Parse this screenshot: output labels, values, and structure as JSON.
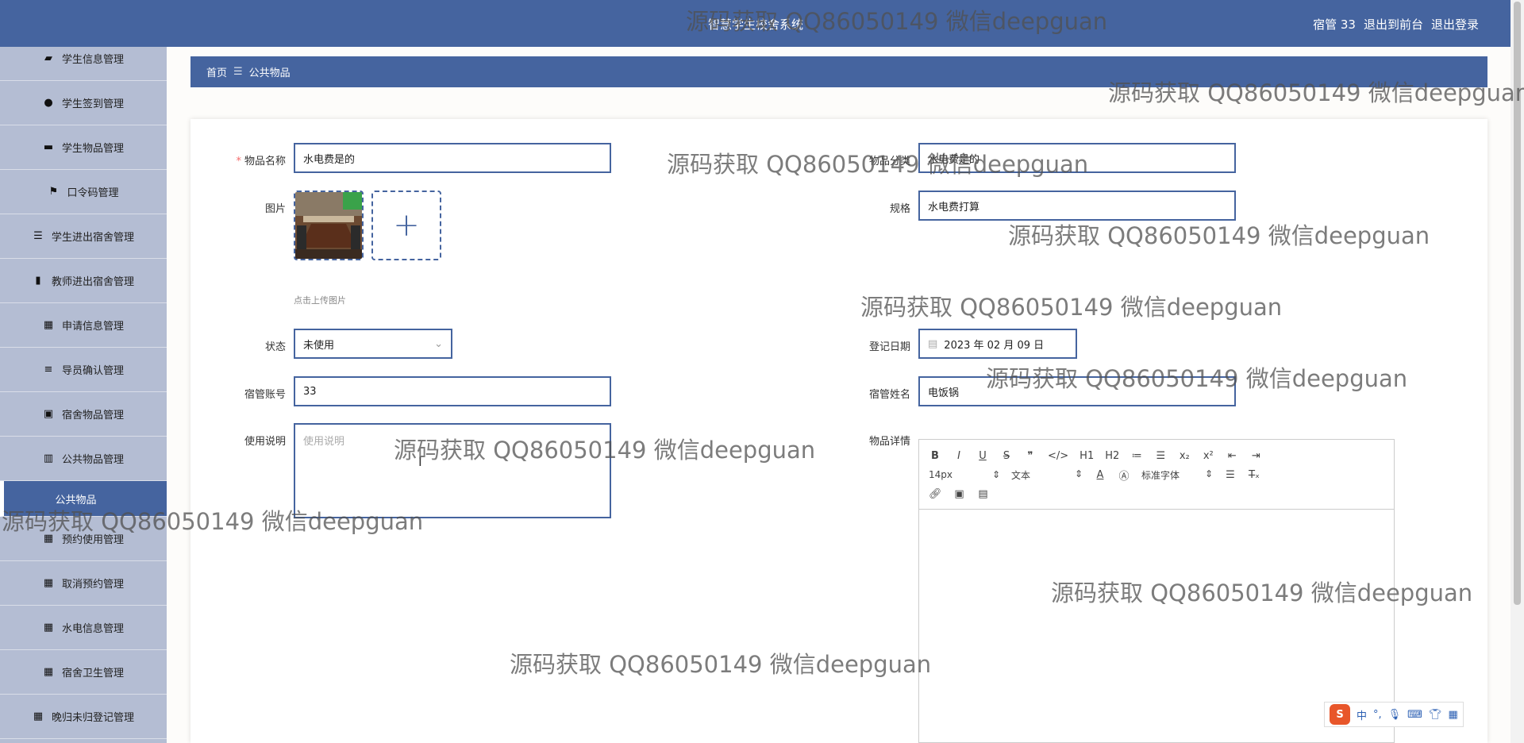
{
  "header": {
    "title": "智慧学生校舍系统",
    "user": "宿管 33",
    "to_front": "退出到前台",
    "logout": "退出登录"
  },
  "sidebar": {
    "items": [
      {
        "label": "学生信息管理",
        "icon": "briefcase-icon"
      },
      {
        "label": "学生签到管理",
        "icon": "pin-icon"
      },
      {
        "label": "学生物品管理",
        "icon": "chat-icon"
      },
      {
        "label": "口令码管理",
        "icon": "flag-icon"
      },
      {
        "label": "学生进出宿舍管理",
        "icon": "sliders-icon"
      },
      {
        "label": "教师进出宿舍管理",
        "icon": "bar-chart-icon"
      },
      {
        "label": "申请信息管理",
        "icon": "grid-icon"
      },
      {
        "label": "导员确认管理",
        "icon": "list-icon"
      },
      {
        "label": "宿舍物品管理",
        "icon": "clipboard-icon"
      },
      {
        "label": "公共物品管理",
        "icon": "library-icon"
      }
    ],
    "active_sub": "公共物品",
    "items_after": [
      {
        "label": "预约使用管理",
        "icon": "grid-icon"
      },
      {
        "label": "取消预约管理",
        "icon": "grid-icon"
      },
      {
        "label": "水电信息管理",
        "icon": "grid-icon"
      },
      {
        "label": "宿舍卫生管理",
        "icon": "grid-icon"
      },
      {
        "label": "晚归未归登记管理",
        "icon": "grid-icon"
      }
    ]
  },
  "breadcrumb": {
    "home": "首页",
    "separator": "☰",
    "current": "公共物品"
  },
  "form": {
    "name_label": "物品名称",
    "name_value": "水电费是的",
    "category_label": "物品分类",
    "category_value": "水电费是的",
    "image_label": "图片",
    "spec_label": "规格",
    "spec_value": "水电费打算",
    "upload_hint": "点击上传图片",
    "status_label": "状态",
    "status_value": "未使用",
    "date_label": "登记日期",
    "date_value": "2023 年 02 月 09 日",
    "account_label": "宿管账号",
    "account_value": "33",
    "manager_name_label": "宿管姓名",
    "manager_name_value": "电饭锅",
    "usage_label": "使用说明",
    "usage_placeholder": "使用说明",
    "detail_label": "物品详情"
  },
  "editor": {
    "row1": [
      "B",
      "I",
      "U",
      "S",
      "❞",
      "</>",
      "H1",
      "H2",
      "≔",
      "☰",
      "x₂",
      "x²",
      "⇤",
      "⇥"
    ],
    "font_size": "14px",
    "paragraph": "文本",
    "font_family": "标准字体",
    "row3_icons": [
      "link-icon",
      "image-icon",
      "video-icon"
    ]
  },
  "watermark_text": "源码获取 QQ86050149 微信deepguan",
  "ime": {
    "logo": "S",
    "lang": "中",
    "punct": "°,"
  },
  "colors": {
    "primary": "#45649f",
    "sidebar": "#b4bdd3",
    "required": "#f56c6c"
  }
}
